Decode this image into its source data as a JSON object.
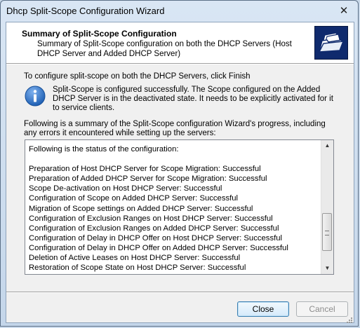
{
  "window": {
    "title": "Dhcp Split-Scope Configuration Wizard",
    "close_glyph": "✕"
  },
  "header": {
    "title": "Summary of Split-Scope Configuration",
    "subtitle": "Summary of Split-Scope configuration on both the DHCP Servers (Host DHCP Server and Added DHCP Server)"
  },
  "body": {
    "instruction": "To configure split-scope on both the DHCP Servers, click Finish",
    "info_message": "Split-Scope is configured successfully. The Scope configured on the Added DHCP Server is in the deactivated state. It needs to be explicitly activated for it to service clients.",
    "summary_intro": "Following is a summary of the Split-Scope configuration Wizard's progress, including any errors it encountered while setting up the servers:"
  },
  "status_list": {
    "lines": [
      "Following is the status of the configuration:",
      "",
      "Preparation of Host DHCP Server for Scope Migration: Successful",
      "Preparation of Added DHCP Server for Scope Migration: Successful",
      "Scope De-activation on Host DHCP Server: Successful",
      "Configuration of Scope on Added DHCP Server: Successful",
      "Migration of Scope settings on Added DHCP Server: Successful",
      "Configuration of Exclusion Ranges on Host DHCP Server: Successful",
      "Configuration of Exclusion Ranges on Added DHCP Server: Successful",
      "Configuration of Delay in DHCP Offer on Host DHCP Server: Successful",
      "Configuration of Delay in DHCP Offer on Added DHCP Server: Successful",
      "Deletion of Active Leases on Host DHCP Server: Successful",
      "Restoration of Scope State on Host DHCP Server: Successful"
    ],
    "scroll_up_glyph": "▲",
    "scroll_down_glyph": "▼"
  },
  "buttons": {
    "close_label": "Close",
    "cancel_label": "Cancel"
  },
  "icons": {
    "header": "folder-documents-icon",
    "info": "info-icon"
  },
  "colors": {
    "header_icon_bg": "#0f2a6d",
    "info_icon": "#1e5fb3",
    "client_bg": "#f0f0f0"
  }
}
